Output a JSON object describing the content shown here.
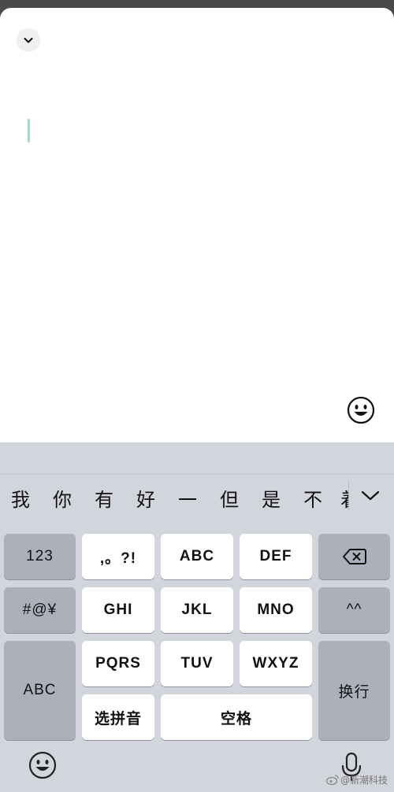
{
  "editor": {
    "collapse_icon": "chevron-down-icon",
    "emoji_icon": "smiley-icon",
    "caret_color": "#9fdcc6"
  },
  "keyboard": {
    "candidates": [
      "我",
      "你",
      "有",
      "好",
      "一",
      "但",
      "是",
      "不",
      "着"
    ],
    "expand_icon": "chevron-down-icon",
    "keys": {
      "numbers": "123",
      "punct": ",。?!",
      "abc": "ABC",
      "def": "DEF",
      "symbols": "#@¥",
      "ghi": "GHI",
      "jkl": "JKL",
      "mno": "MNO",
      "emoticon": "^^",
      "pqrs": "PQRS",
      "tuv": "TUV",
      "wxyz": "WXYZ",
      "switch_abc": "ABC",
      "newline": "换行",
      "select_pinyin": "选拼音",
      "space": "空格"
    },
    "backspace_icon": "backspace-icon",
    "bottom_emoji_icon": "smiley-icon",
    "mic_icon": "microphone-icon"
  },
  "watermark": {
    "text": "@新潮科技",
    "icon": "weibo-icon"
  }
}
